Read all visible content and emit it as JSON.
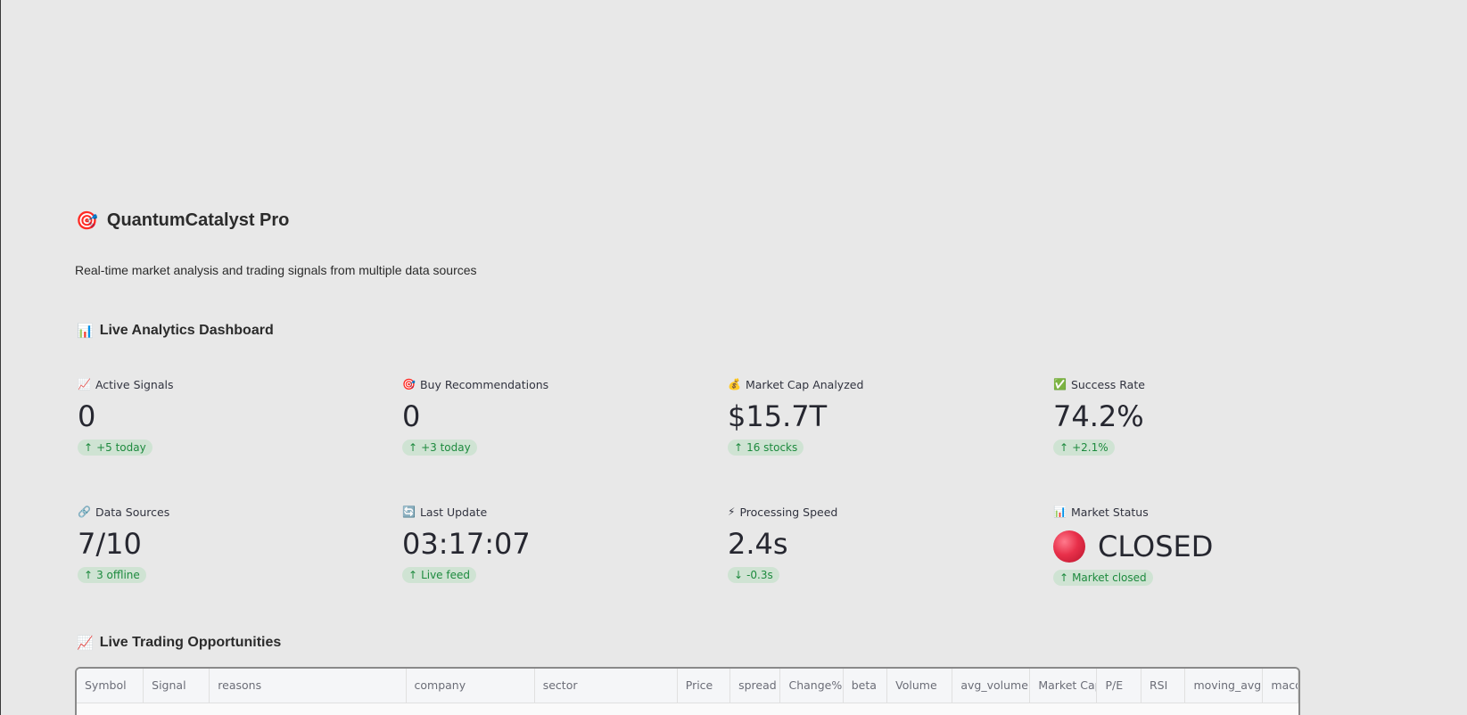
{
  "app": {
    "icon": "target-icon",
    "icon_glyph": "🎯",
    "title": "QuantumCatalyst Pro",
    "subtitle": "Real-time market analysis and trading signals from multiple data sources"
  },
  "dashboard": {
    "icon_glyph": "📊",
    "title": "Live Analytics Dashboard",
    "metrics": [
      {
        "icon": "chart-up-icon",
        "icon_glyph": "📈",
        "label": "Active Signals",
        "value": "0",
        "delta": "+5 today",
        "delta_dir": "up"
      },
      {
        "icon": "target-icon",
        "icon_glyph": "🎯",
        "label": "Buy Recommendations",
        "value": "0",
        "delta": "+3 today",
        "delta_dir": "up"
      },
      {
        "icon": "money-bag-icon",
        "icon_glyph": "💰",
        "label": "Market Cap Analyzed",
        "value": "$15.7T",
        "delta": "16 stocks",
        "delta_dir": "up"
      },
      {
        "icon": "check-icon",
        "icon_glyph": "✅",
        "label": "Success Rate",
        "value": "74.2%",
        "delta": "+2.1%",
        "delta_dir": "up"
      },
      {
        "icon": "link-icon",
        "icon_glyph": "🔗",
        "label": "Data Sources",
        "value": "7/10",
        "delta": "3 offline",
        "delta_dir": "up"
      },
      {
        "icon": "refresh-icon",
        "icon_glyph": "🔄",
        "label": "Last Update",
        "value": "03:17:07",
        "delta": "Live feed",
        "delta_dir": "up"
      },
      {
        "icon": "lightning-icon",
        "icon_glyph": "⚡",
        "label": "Processing Speed",
        "value": "2.4s",
        "delta": "-0.3s",
        "delta_dir": "down"
      },
      {
        "icon": "bar-chart-icon",
        "icon_glyph": "📊",
        "label": "Market Status",
        "value": "CLOSED",
        "delta": "Market closed",
        "delta_dir": "up",
        "status_color": "#e8304a"
      }
    ]
  },
  "opportunities": {
    "icon_glyph": "📈",
    "title": "Live Trading Opportunities",
    "columns": [
      "Symbol",
      "Signal",
      "reasons",
      "company",
      "sector",
      "Price",
      "spread",
      "Change%",
      "beta",
      "Volume",
      "avg_volume",
      "Market Cap",
      "P/E",
      "RSI",
      "moving_avg",
      "macd"
    ]
  },
  "colors": {
    "background": "#e8e8e8",
    "delta_bg": "#cfe3d3",
    "delta_text": "#1d8a3e",
    "table_border": "#8a8a8a"
  }
}
